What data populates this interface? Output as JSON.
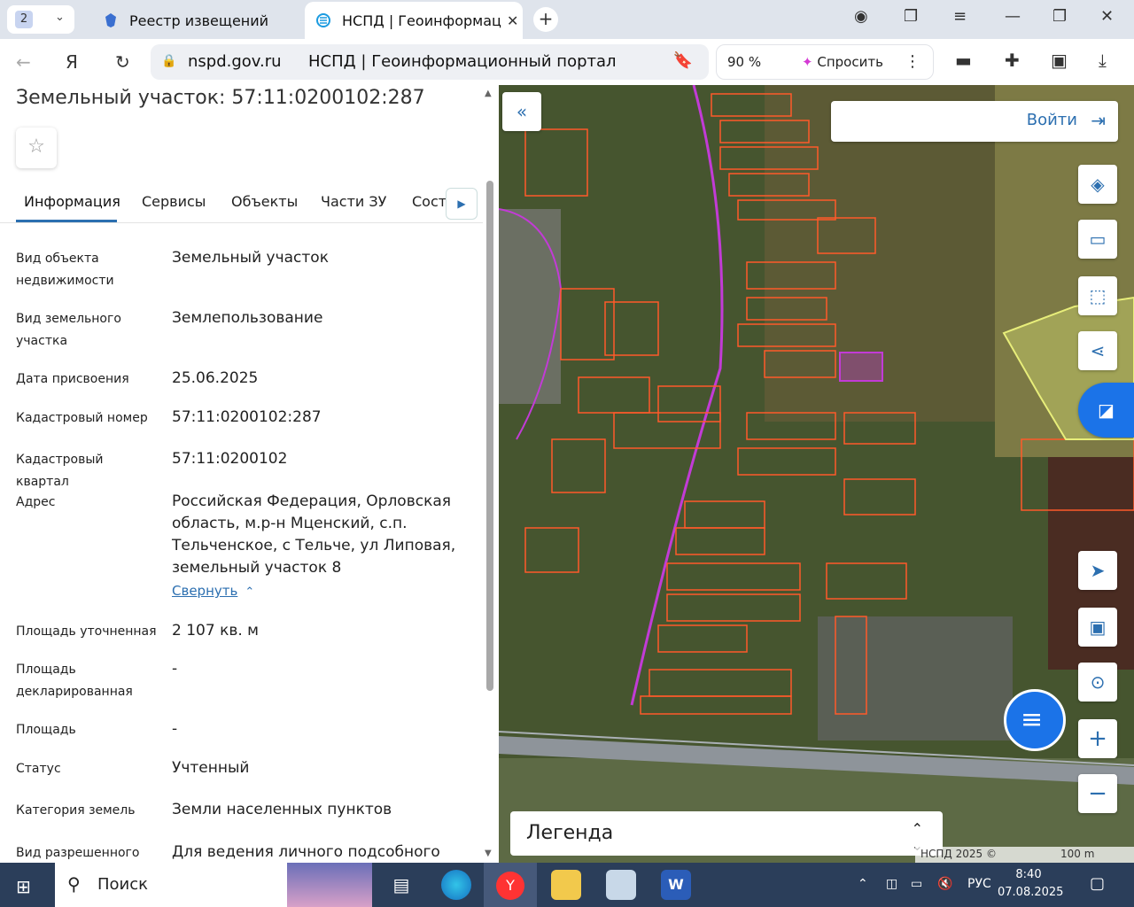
{
  "browser": {
    "tab_count": "2",
    "tabs": [
      {
        "label": "Реестр извещений"
      },
      {
        "label": "НСПД | Геоинформаци"
      }
    ],
    "url_host": "nspd.gov.ru",
    "page_title": "НСПД | Геоинформационный портал",
    "zoom": "90 %",
    "ask_label": "Спросить"
  },
  "panel": {
    "title": "Земельный участок: 57:11:0200102:287",
    "tabs": [
      "Информация",
      "Сервисы",
      "Объекты",
      "Части ЗУ",
      "Соста"
    ],
    "rows": [
      {
        "key": "Вид объекта недвижимости",
        "value": "Земельный участок"
      },
      {
        "key": "Вид земельного участка",
        "value": "Землепользование"
      },
      {
        "key": "Дата присвоения",
        "value": "25.06.2025"
      },
      {
        "key": "Кадастровый номер",
        "value": "57:11:0200102:287"
      },
      {
        "key": "Кадастровый квартал",
        "value": "57:11:0200102"
      },
      {
        "key": "Адрес",
        "value": "Российская Федерация, Орловская область, м.р-н Мценский, с.п. Тельченское, с Тельче, ул Липовая, земельный участок 8"
      },
      {
        "key": "Площадь уточненная",
        "value": "2 107 кв. м"
      },
      {
        "key": "Площадь декларированная",
        "value": "-"
      },
      {
        "key": "Площадь",
        "value": "-"
      },
      {
        "key": "Статус",
        "value": "Учтенный"
      },
      {
        "key": "Категория земель",
        "value": "Земли населенных пунктов"
      },
      {
        "key": "Вид разрешенного",
        "value": "Для ведения личного подсобного"
      }
    ],
    "collapse_label": "Свернуть"
  },
  "map": {
    "login_label": "Войти",
    "legend_label": "Легенда",
    "attribution": "НСПД 2025 ©",
    "scale": "100 m"
  },
  "taskbar": {
    "search_label": "Поиск",
    "lang": "РУС",
    "time": "8:40",
    "date": "07.08.2025"
  },
  "colors": {
    "accent": "#2c6fb0",
    "parcel": "#ff5a2a",
    "selected": "#c23bd6"
  }
}
